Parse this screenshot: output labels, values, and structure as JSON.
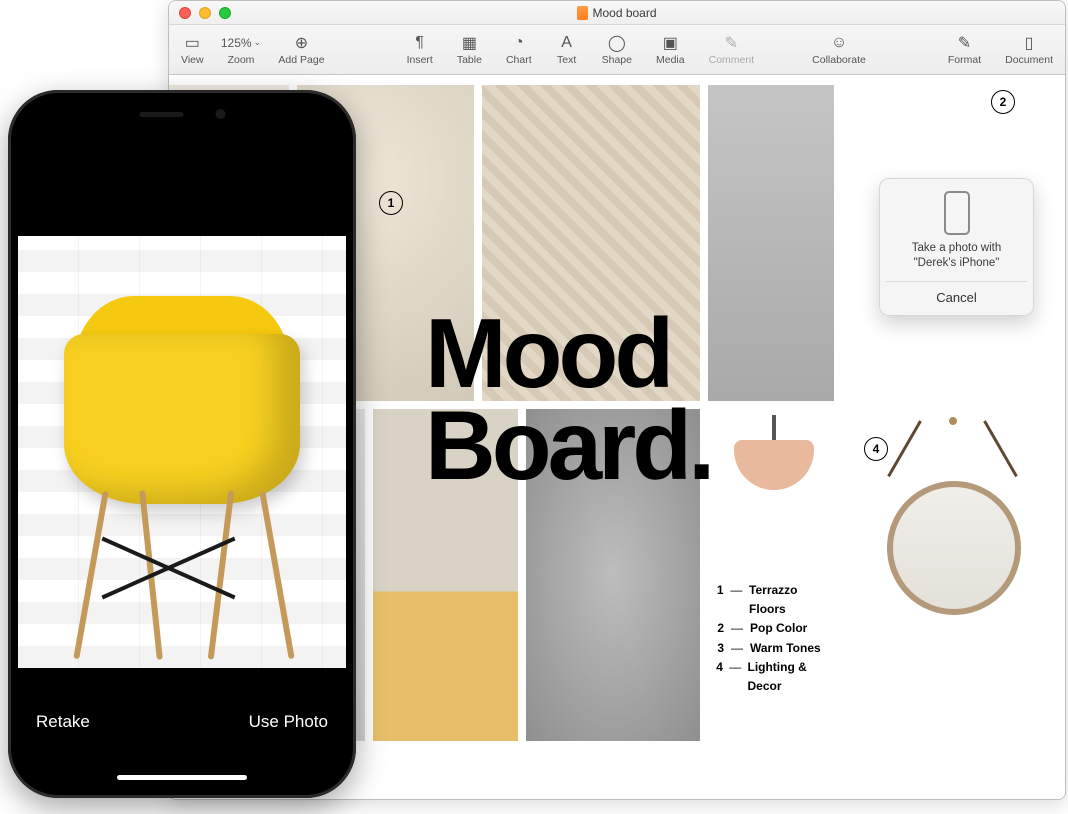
{
  "window": {
    "title": "Mood board",
    "zoom": "125%"
  },
  "toolbar": {
    "view": "View",
    "zoom": "Zoom",
    "addPage": "Add Page",
    "insert": "Insert",
    "table": "Table",
    "chart": "Chart",
    "text": "Text",
    "shape": "Shape",
    "media": "Media",
    "comment": "Comment",
    "collaborate": "Collaborate",
    "format": "Format",
    "document": "Document"
  },
  "doc": {
    "headline": "Mood\nBoard.",
    "legend": [
      {
        "n": "1",
        "label": "Terrazzo Floors"
      },
      {
        "n": "2",
        "label": "Pop Color"
      },
      {
        "n": "3",
        "label": "Warm Tones"
      },
      {
        "n": "4",
        "label": "Lighting & Decor"
      }
    ],
    "callouts": {
      "c1": "1",
      "c2": "2",
      "c4": "4"
    }
  },
  "popover": {
    "text": "Take a photo with \"Derek's iPhone\"",
    "cancel": "Cancel"
  },
  "iphone": {
    "retake": "Retake",
    "usePhoto": "Use Photo"
  }
}
